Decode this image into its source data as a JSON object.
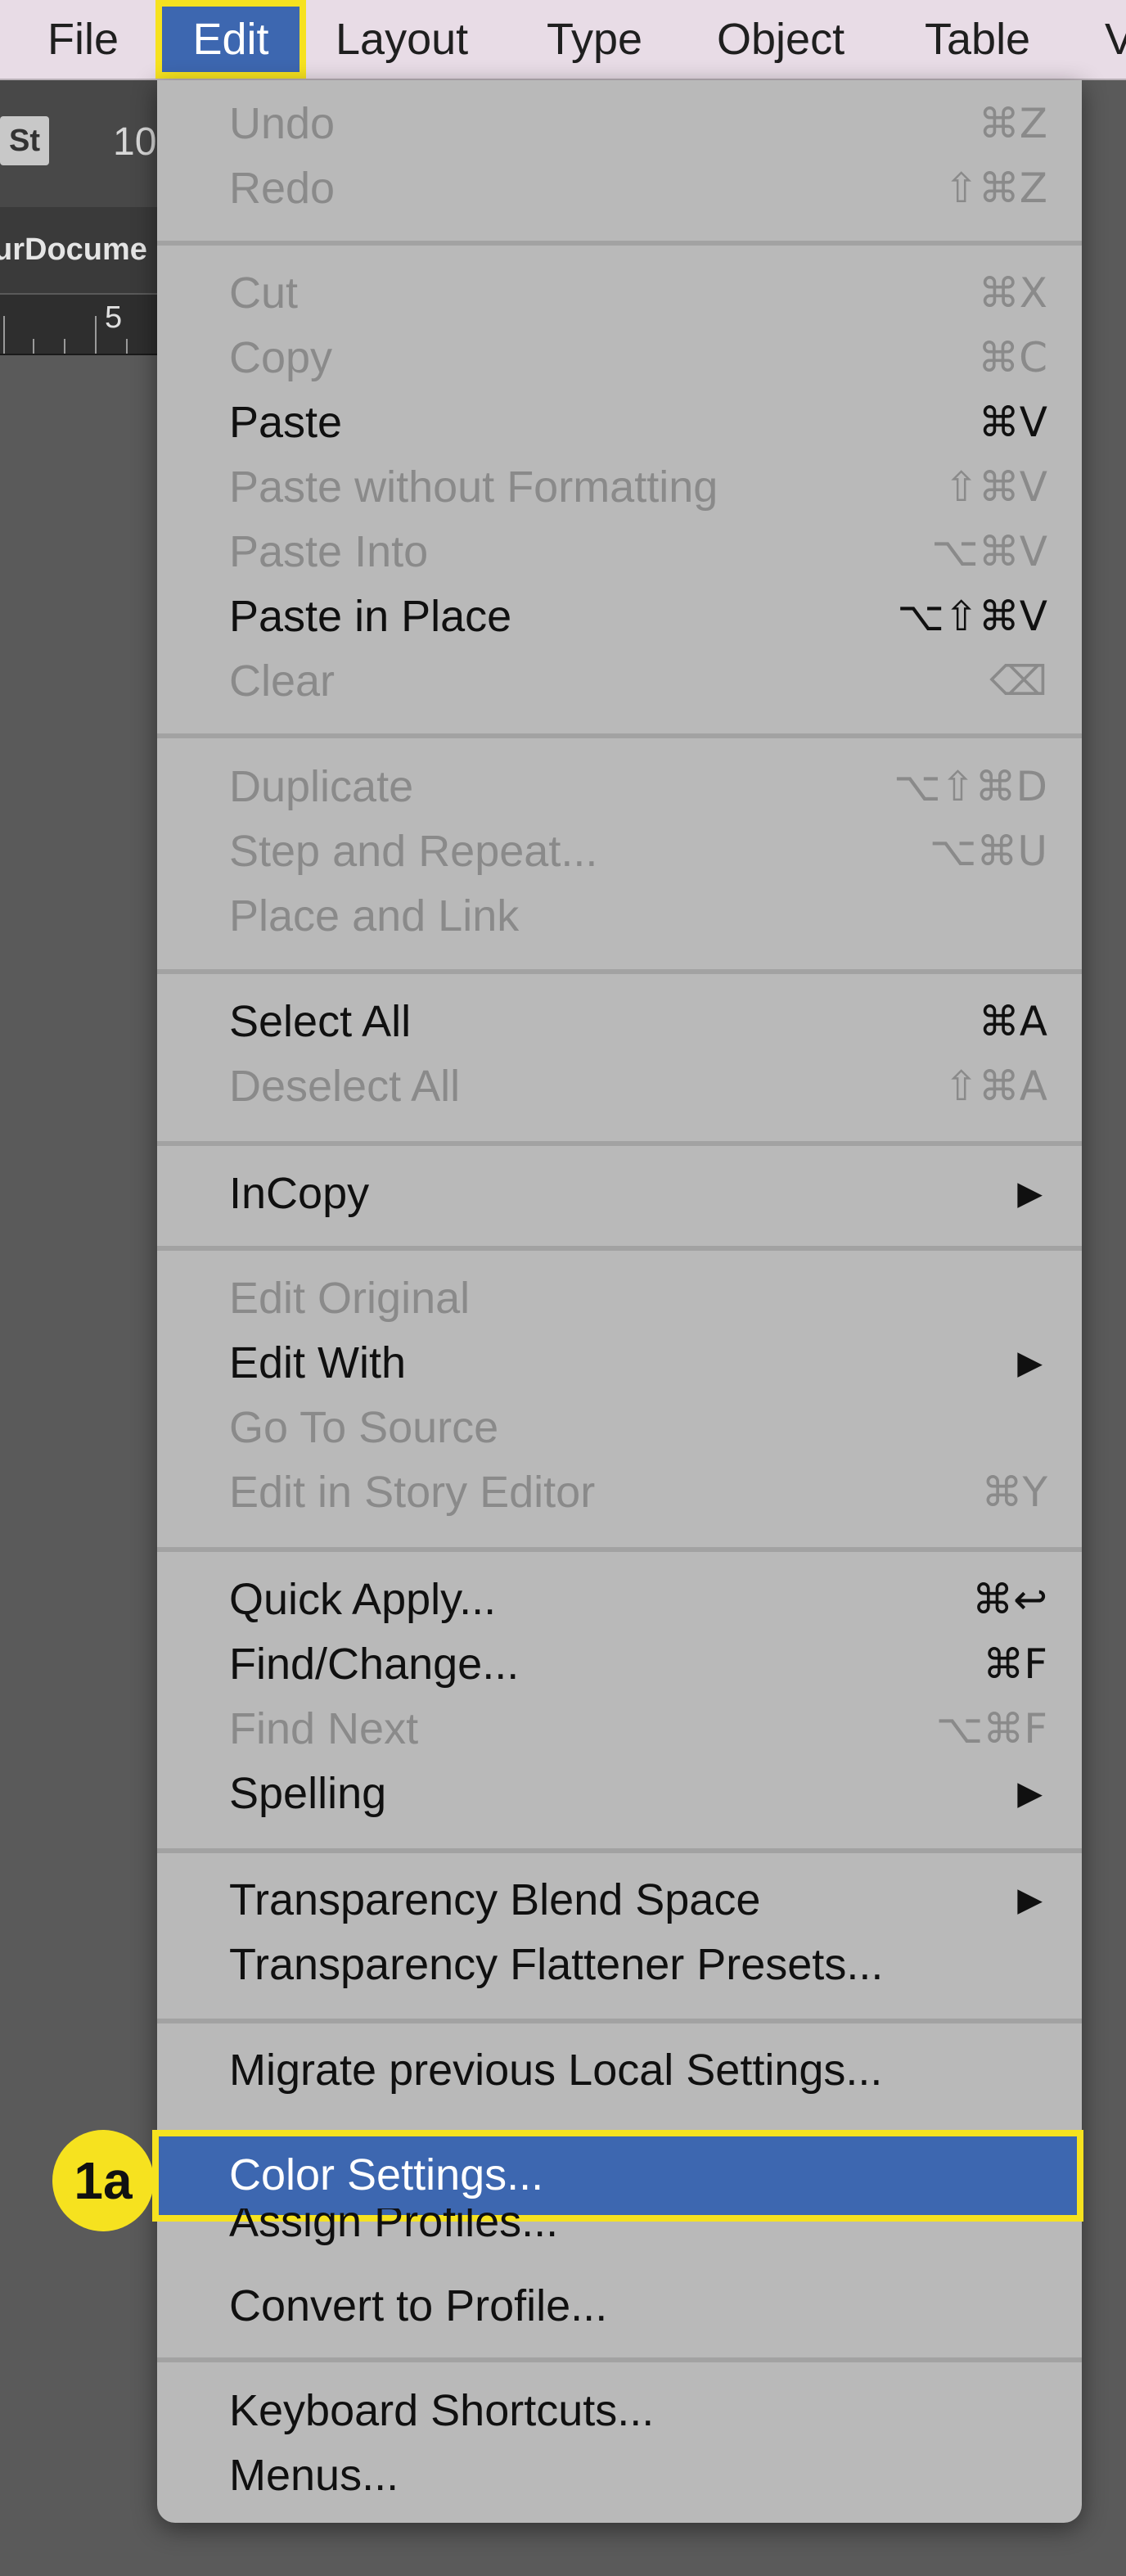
{
  "menubar": {
    "items": [
      "File",
      "Edit",
      "Layout",
      "Type",
      "Object",
      "Table",
      "V"
    ],
    "selected": "Edit"
  },
  "control_bar": {
    "st_label": "St",
    "zoom_value": "10"
  },
  "document_tab": {
    "title": "urDocume"
  },
  "ruler": {
    "label": "5"
  },
  "edit_menu": {
    "items": [
      {
        "label": "Undo",
        "shortcut": "⌘Z",
        "enabled": false
      },
      {
        "label": "Redo",
        "shortcut": "⇧⌘Z",
        "enabled": false
      },
      {
        "label": "Cut",
        "shortcut": "⌘X",
        "enabled": false
      },
      {
        "label": "Copy",
        "shortcut": "⌘C",
        "enabled": false
      },
      {
        "label": "Paste",
        "shortcut": "⌘V",
        "enabled": true
      },
      {
        "label": "Paste without Formatting",
        "shortcut": "⇧⌘V",
        "enabled": false
      },
      {
        "label": "Paste Into",
        "shortcut": "⌥⌘V",
        "enabled": false
      },
      {
        "label": "Paste in Place",
        "shortcut": "⌥⇧⌘V",
        "enabled": true
      },
      {
        "label": "Clear",
        "shortcut": "⌫",
        "enabled": false
      },
      {
        "label": "Duplicate",
        "shortcut": "⌥⇧⌘D",
        "enabled": false
      },
      {
        "label": "Step and Repeat...",
        "shortcut": "⌥⌘U",
        "enabled": false
      },
      {
        "label": "Place and Link",
        "shortcut": "",
        "enabled": false
      },
      {
        "label": "Select All",
        "shortcut": "⌘A",
        "enabled": true
      },
      {
        "label": "Deselect All",
        "shortcut": "⇧⌘A",
        "enabled": false
      },
      {
        "label": "InCopy",
        "shortcut": "",
        "submenu_arrow": "▶",
        "enabled": true
      },
      {
        "label": "Edit Original",
        "shortcut": "",
        "enabled": false
      },
      {
        "label": "Edit With",
        "shortcut": "",
        "submenu_arrow": "▶",
        "enabled": true
      },
      {
        "label": "Go To Source",
        "shortcut": "",
        "enabled": false
      },
      {
        "label": "Edit in Story Editor",
        "shortcut": "⌘Y",
        "enabled": false
      },
      {
        "label": "Quick Apply...",
        "shortcut": "⌘↩",
        "enabled": true
      },
      {
        "label": "Find/Change...",
        "shortcut": "⌘F",
        "enabled": true
      },
      {
        "label": "Find Next",
        "shortcut": "⌥⌘F",
        "enabled": false
      },
      {
        "label": "Spelling",
        "shortcut": "",
        "submenu_arrow": "▶",
        "enabled": true
      },
      {
        "label": "Transparency Blend Space",
        "shortcut": "",
        "submenu_arrow": "▶",
        "enabled": true
      },
      {
        "label": "Transparency Flattener Presets...",
        "shortcut": "",
        "enabled": true
      },
      {
        "label": "Migrate previous Local Settings...",
        "shortcut": "",
        "enabled": true
      },
      {
        "label": "Color Settings...",
        "shortcut": "",
        "enabled": true,
        "selected": true
      },
      {
        "label": "Assign Profiles...",
        "shortcut": "",
        "enabled": true
      },
      {
        "label": "Convert to Profile...",
        "shortcut": "",
        "enabled": true
      },
      {
        "label": "Keyboard Shortcuts...",
        "shortcut": "",
        "enabled": true
      },
      {
        "label": "Menus...",
        "shortcut": "",
        "enabled": true
      }
    ]
  },
  "annotation": {
    "step_label": "1a"
  },
  "colors": {
    "menubar_bg": "#e8dce6",
    "menu_bg": "#b9b9b9",
    "disabled_text": "#8a8a8a",
    "selection_blue": "#3d67b0",
    "callout_yellow": "#f6e21f",
    "workspace_bg": "#5a5a5a"
  }
}
